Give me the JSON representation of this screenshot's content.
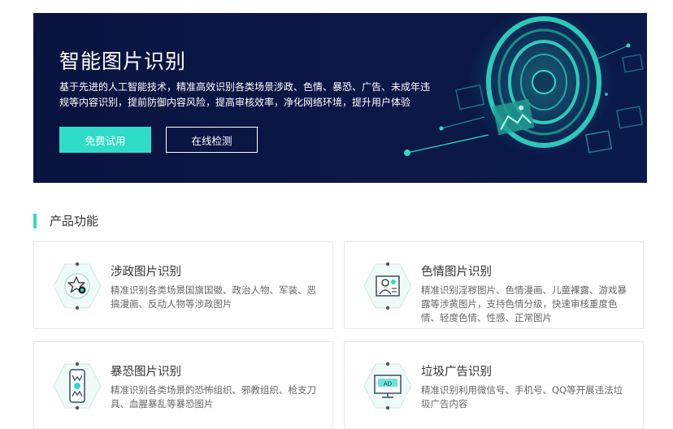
{
  "hero": {
    "title": "智能图片识别",
    "description": "基于先进的人工智能技术，精准高效识别各类场景涉政、色情、暴恐、广告、未成年违规等内容识别，提前防御内容风险，提高审核效率，净化网络环境，提升用户体验",
    "trial_button": "免费试用",
    "online_button": "在线检测",
    "ad_label": "AD"
  },
  "section": {
    "title": "产品功能"
  },
  "cards": [
    {
      "title": "涉政图片识别",
      "desc": "精准识别各类场景国旗国徽、政治人物、军装、恶搞漫画、反动人物等涉政图片",
      "icon": "star-icon"
    },
    {
      "title": "色情图片识别",
      "desc": "精准识别淫秽图片、色情漫画、儿童裸露、游戏暴露等涉黄图片，支持色情分级，快速审核重度色情、轻度色情、性感、正常图片",
      "icon": "person-image-icon"
    },
    {
      "title": "暴恐图片识别",
      "desc": "精准识别各类场景的恐怖组织、邪教组织、枪支刀具、血腥暴乱等暴恐图片",
      "icon": "weapon-icon"
    },
    {
      "title": "垃圾广告识别",
      "desc": "精准识别利用微信号、手机号、QQ等开展违法垃圾广告内容",
      "icon": "ad-monitor-icon"
    }
  ],
  "colors": {
    "accent": "#2fdcc8",
    "hero_bg": "#0a1440"
  }
}
